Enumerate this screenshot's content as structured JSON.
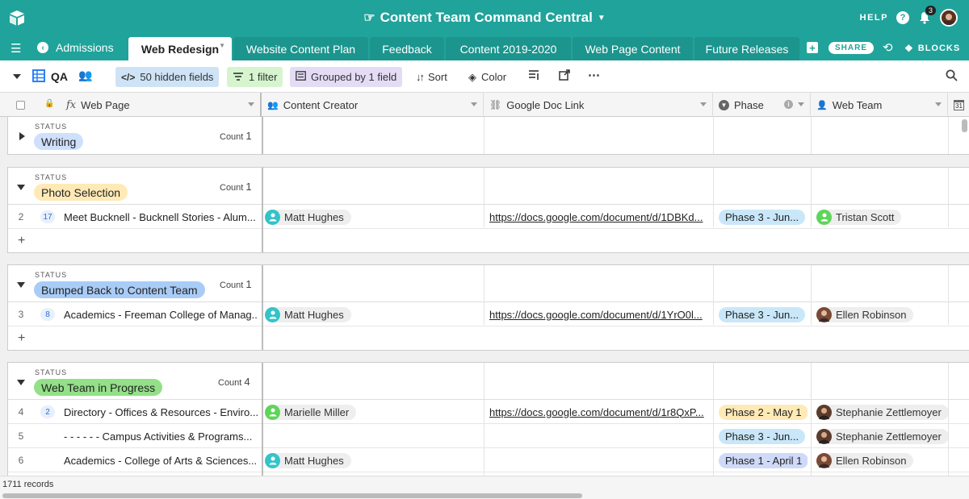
{
  "topbar": {
    "title": "Content Team Command Central",
    "help_label": "HELP",
    "notification_count": "3",
    "help_icon_label": "?"
  },
  "tabs": {
    "nav_label": "Admissions",
    "items": [
      "Web Redesign",
      "Website Content Plan",
      "Feedback",
      "Content 2019-2020",
      "Web Page Content",
      "Future Releases"
    ],
    "share_label": "SHARE",
    "blocks_label": "BLOCKS"
  },
  "toolbar": {
    "view_name": "QA",
    "hidden_fields": "50 hidden fields",
    "filter": "1 filter",
    "grouped": "Grouped by 1 field",
    "sort": "Sort",
    "color": "Color"
  },
  "columns": {
    "web_page": "Web Page",
    "content_creator": "Content Creator",
    "google_doc": "Google Doc Link",
    "phase": "Phase",
    "web_team": "Web Team",
    "last_icon": "31"
  },
  "groups": [
    {
      "status_label": "STATUS",
      "name": "Writing",
      "count_label": "Count",
      "count": "1",
      "color": "#cfe0fc"
    },
    {
      "status_label": "STATUS",
      "name": "Photo Selection",
      "count_label": "Count",
      "count": "1",
      "color": "#ffeab6"
    },
    {
      "status_label": "STATUS",
      "name": "Bumped Back to Content Team",
      "count_label": "Count",
      "count": "1",
      "color": "#a9ccf7"
    },
    {
      "status_label": "STATUS",
      "name": "Web Team in Progress",
      "count_label": "Count",
      "count": "4",
      "color": "#93e088"
    }
  ],
  "rows": [
    {
      "num": "2",
      "comments": "17",
      "web_page": "Meet Bucknell - Bucknell Stories - Alum...",
      "creator": "Matt Hughes",
      "creator_avatar": "teal",
      "doc": "https://docs.google.com/document/d/1DBKd...",
      "phase": "Phase 3 - Jun...",
      "phase_color": "#c9e7f9",
      "team": "Tristan Scott",
      "team_avatar": "green"
    },
    {
      "num": "3",
      "comments": "8",
      "web_page": "Academics - Freeman College of Manag...",
      "creator": "Matt Hughes",
      "creator_avatar": "teal",
      "doc": "https://docs.google.com/document/d/1YrO0l...",
      "phase": "Phase 3 - Jun...",
      "phase_color": "#c9e7f9",
      "team": "Ellen Robinson",
      "team_avatar": "photo"
    },
    {
      "num": "4",
      "comments": "2",
      "web_page": "Directory - Offices & Resources - Enviro...",
      "creator": "Marielle Miller",
      "creator_avatar": "green",
      "doc": "https://docs.google.com/document/d/1r8QxP...",
      "phase": "Phase 2 - May 1",
      "phase_color": "#ffeab6",
      "team": "Stephanie Zettlemoyer",
      "team_avatar": "photo"
    },
    {
      "num": "5",
      "comments": "",
      "web_page": "- - - - - - Campus Activities & Programs...",
      "creator": "",
      "creator_avatar": "",
      "doc": "",
      "phase": "Phase 3 - Jun...",
      "phase_color": "#c9e7f9",
      "team": "Stephanie Zettlemoyer",
      "team_avatar": "photo"
    },
    {
      "num": "6",
      "comments": "",
      "web_page": "Academics - College of Arts & Sciences...",
      "creator": "Matt Hughes",
      "creator_avatar": "teal",
      "doc": "",
      "phase": "Phase 1 - April 1",
      "phase_color": "#cfdaf9",
      "team": "Ellen Robinson",
      "team_avatar": "photo"
    }
  ],
  "footer": {
    "records": "1711 records"
  },
  "add_row_label": "+"
}
